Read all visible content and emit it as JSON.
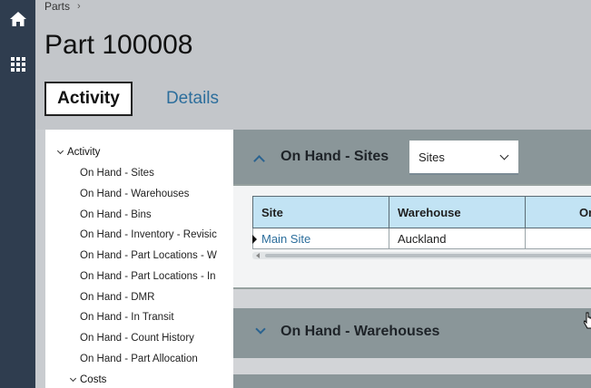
{
  "rail": {
    "home_icon": "home-icon",
    "apps_icon": "apps-grid-icon"
  },
  "breadcrumb": {
    "parent": "Parts",
    "separator": "›"
  },
  "page": {
    "title": "Part 100008"
  },
  "tabs": [
    {
      "label": "Activity",
      "active": true
    },
    {
      "label": "Details",
      "active": false
    }
  ],
  "tree": {
    "groups": [
      {
        "label": "Activity",
        "items": [
          "On Hand - Sites",
          "On Hand - Warehouses",
          "On Hand - Bins",
          "On Hand - Inventory - Revisic",
          "On Hand - Part Locations - W",
          "On Hand - Part Locations - In",
          "On Hand - DMR",
          "On Hand - In Transit",
          "On Hand - Count History",
          "On Hand - Part Allocation"
        ]
      },
      {
        "label": "Costs",
        "items": []
      }
    ]
  },
  "sections": {
    "sites": {
      "title": "On Hand - Sites",
      "expanded": true,
      "select_value": "Sites",
      "grid": {
        "columns": [
          "Site",
          "Warehouse",
          "On"
        ],
        "rows": [
          {
            "site": "Main Site",
            "warehouse": "Auckland",
            "on": ""
          }
        ]
      }
    },
    "warehouses": {
      "title": "On Hand - Warehouses",
      "expanded": false
    }
  },
  "colors": {
    "rail": "#2f3d4f",
    "link": "#2c6e9c",
    "section_header": "#8a9699",
    "grid_header": "#c2e3f4"
  }
}
